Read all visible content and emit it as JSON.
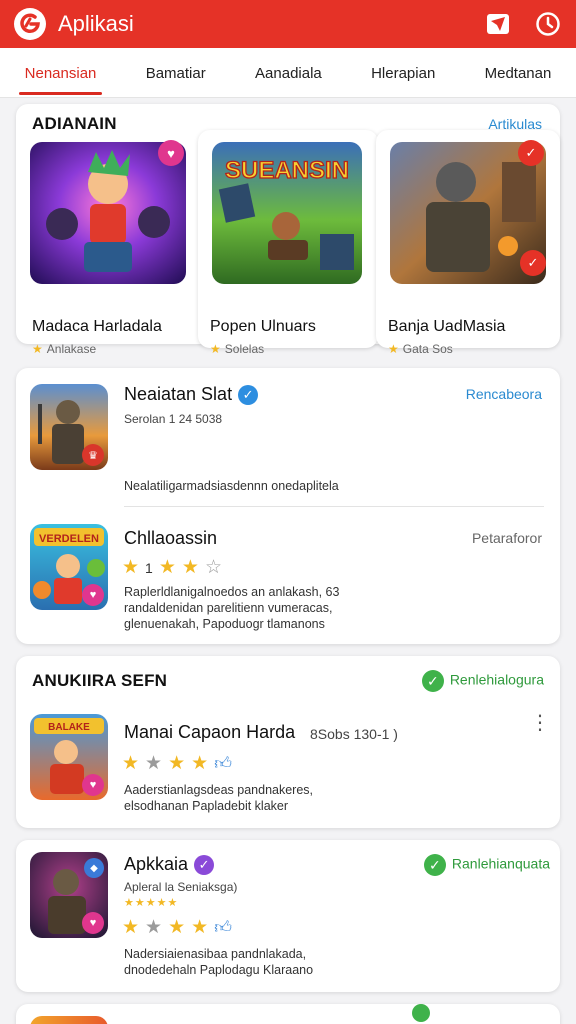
{
  "appbar": {
    "title": "Aplikasi",
    "logo_icon": "logo-icon",
    "icons": [
      "share-icon",
      "clock-icon"
    ]
  },
  "tabs": [
    {
      "label": "Nenansian",
      "active": true
    },
    {
      "label": "Bamatiar",
      "active": false
    },
    {
      "label": "Aanadiala",
      "active": false
    },
    {
      "label": "Hlerapian",
      "active": false
    },
    {
      "label": "Medtanan",
      "active": false
    }
  ],
  "featured": {
    "title": "ADIANAIN",
    "link": "Artikulas",
    "items": [
      {
        "name": "Madaca Harladala",
        "meta": "Anlakase"
      },
      {
        "name": "Popen Ulnuars",
        "meta": "Solelas",
        "banner": "SUEANSIN"
      },
      {
        "name": "Banja UadMasia",
        "meta": "Gata Sos"
      }
    ]
  },
  "list1": {
    "rows": [
      {
        "title": "Neaiatan Slat",
        "sub": "Serolan 1 24 5038",
        "desc": "Nealatiligarmadsiasdennn onedaplitela",
        "action": "Rencabeora"
      },
      {
        "title": "Chllaoassin",
        "rating_num": "1",
        "desc": "Raplerldlanigalnoedos an anlakash, 63 randaldenidan parelitienn vumeracas, glenuenakah, Papoduogr tlamanons",
        "action": "Petaraforor",
        "icon_banner": "VERDELEN"
      }
    ]
  },
  "section2": {
    "title": "ANUKIIRA SEFN",
    "link": "Renlehialogura",
    "rows": [
      {
        "title": "Manai Capaon Harda",
        "sub": "8Sobs 130-1 )",
        "desc": "Aaderstianlagsdeas pandnakeres, elsodhanan Papladebit klaker",
        "icon_banner": "BALAKE"
      },
      {
        "title": "Apkkaia",
        "sub": "Apleral la Seniaksga)",
        "desc": "Nadersiaienasibaa pandnlakada, dnodedehaln Paplodagu Klaraano",
        "action": "Ranlehianquata"
      }
    ]
  },
  "colors": {
    "brand_red": "#e53227",
    "link_blue": "#2a8ad0",
    "star_gold": "#f2b824",
    "check_green": "#3fb24a"
  }
}
